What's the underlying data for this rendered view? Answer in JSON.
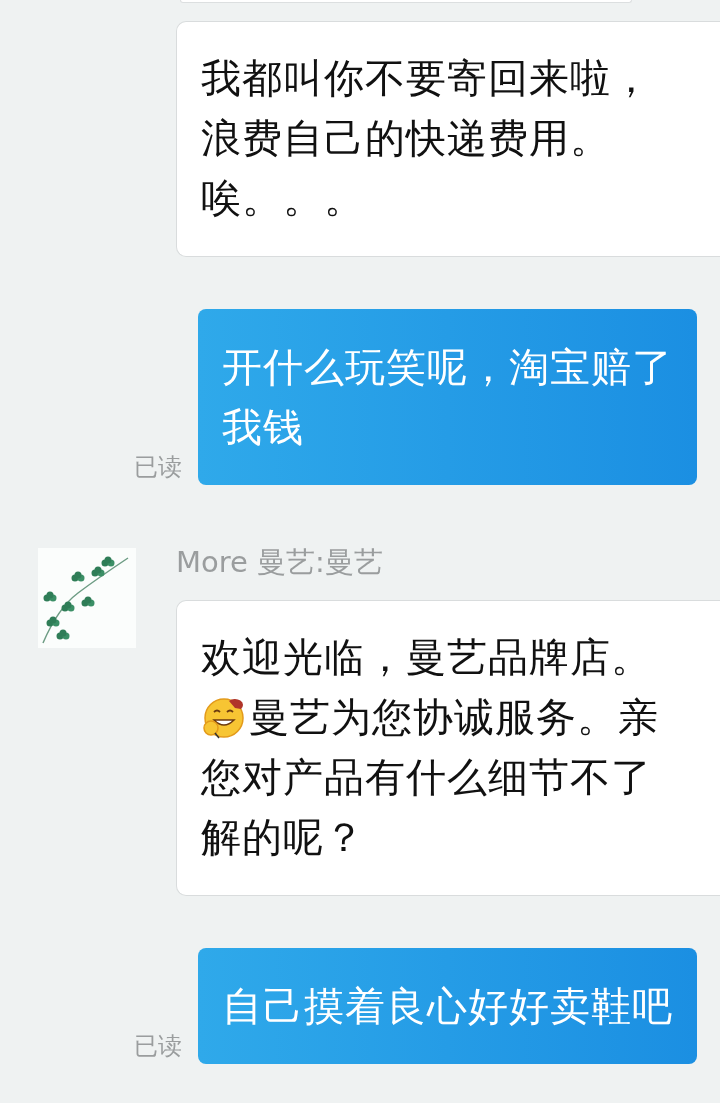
{
  "messages": [
    {
      "kind": "partial"
    },
    {
      "kind": "incoming",
      "lines": [
        {
          "kind": "text",
          "text": "我都叫你不要寄回来啦，"
        },
        {
          "kind": "text",
          "text": "浪费自己的快递费用。"
        },
        {
          "kind": "text",
          "text": "唉。。。"
        }
      ]
    },
    {
      "kind": "outgoing",
      "read_label": "已读",
      "lines": [
        {
          "kind": "text",
          "text": "开什么玩笑呢，淘宝赔了"
        },
        {
          "kind": "text",
          "text": "我钱"
        }
      ]
    },
    {
      "kind": "incoming",
      "sender": "More 曼艺:曼艺",
      "avatar": {
        "kind": "picture"
      },
      "lines": [
        {
          "kind": "text",
          "text": "欢迎光临，曼艺品牌店。"
        },
        {
          "kind": "emoji_text",
          "text": "曼艺为您协诚服务。亲"
        },
        {
          "kind": "text",
          "text": "您对产品有什么细节不了"
        },
        {
          "kind": "text",
          "text": "解的呢？"
        }
      ]
    },
    {
      "kind": "outgoing",
      "read_label": "已读",
      "lines": [
        {
          "kind": "text",
          "text": "自己摸着良心好好卖鞋吧"
        }
      ]
    }
  ]
}
